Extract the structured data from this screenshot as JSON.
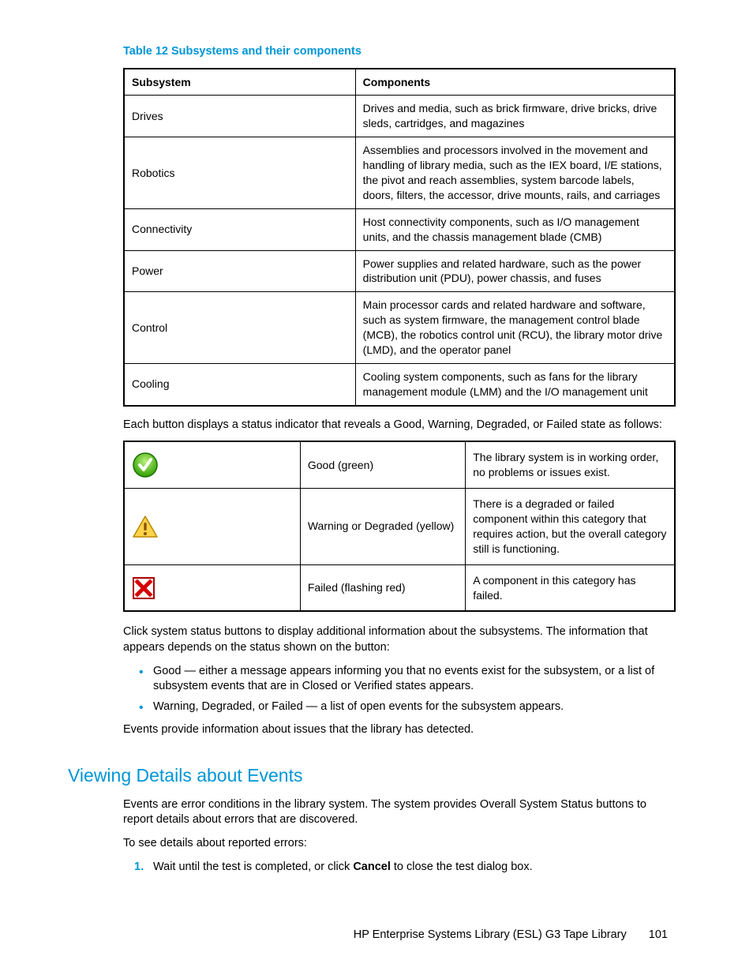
{
  "table1": {
    "caption": "Table 12 Subsystems and their components",
    "headers": [
      "Subsystem",
      "Components"
    ],
    "rows": [
      {
        "sub": "Drives",
        "comp": "Drives and media, such as brick firmware, drive bricks, drive sleds, cartridges, and magazines"
      },
      {
        "sub": "Robotics",
        "comp": "Assemblies and processors involved in the movement and handling of library media, such as the IEX board, I/E stations, the pivot and reach assemblies, system barcode labels, doors, filters, the accessor, drive mounts, rails, and carriages"
      },
      {
        "sub": "Connectivity",
        "comp": "Host connectivity components, such as I/O management units, and the chassis management blade (CMB)"
      },
      {
        "sub": "Power",
        "comp": "Power supplies and related hardware, such as the power distribution unit (PDU), power chassis, and fuses"
      },
      {
        "sub": "Control",
        "comp": "Main processor cards and related hardware and software, such as system firmware, the management control blade (MCB), the robotics control unit (RCU), the library motor drive (LMD), and the operator panel"
      },
      {
        "sub": "Cooling",
        "comp": "Cooling system components, such as fans for the library management module (LMM) and the I/O management unit"
      }
    ]
  },
  "para1": "Each button displays a status indicator that reveals a Good, Warning, Degraded, or Failed state as follows:",
  "table2": {
    "rows": [
      {
        "icon": "good",
        "label": "Good (green)",
        "desc": "The library system is in working order, no problems or issues exist."
      },
      {
        "icon": "warning",
        "label": "Warning or Degraded (yellow)",
        "desc": "There is a degraded or failed component within this category that requires action, but the overall category still is functioning."
      },
      {
        "icon": "failed",
        "label": "Failed (flashing red)",
        "desc": "A component in this category has failed."
      }
    ]
  },
  "para2": "Click system status buttons to display additional information about the subsystems. The information that appears depends on the status shown on the button:",
  "bullets": [
    "Good — either a message appears informing you that no events exist for the subsystem, or a list of subsystem events that are in Closed or Verified states appears.",
    "Warning, Degraded, or Failed — a list of open events for the subsystem appears."
  ],
  "para3": "Events provide information about issues that the library has detected.",
  "section_heading": "Viewing Details about Events",
  "para4": "Events are error conditions in the library system. The system provides Overall System Status buttons to report details about errors that are discovered.",
  "para5": "To see details about reported errors:",
  "step1_a": "Wait until the test is completed, or click ",
  "step1_b": "Cancel",
  "step1_c": " to close the test dialog box.",
  "footer": {
    "title": "HP Enterprise Systems Library (ESL) G3 Tape Library",
    "page": "101"
  }
}
